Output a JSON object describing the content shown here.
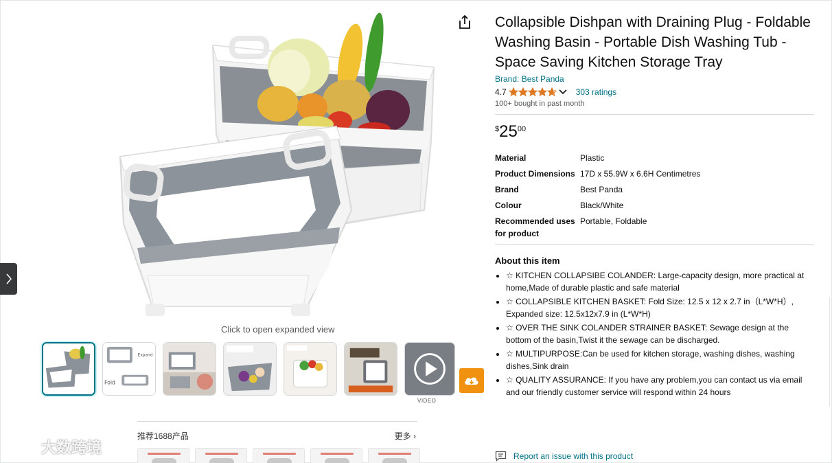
{
  "product": {
    "title": "Collapsible Dishpan with Draining Plug - Foldable Washing Basin - Portable Dish Washing Tub - Space Saving Kitchen Storage Tray",
    "brand_link": "Brand: Best Panda",
    "rating_value": "4.7",
    "rating_stars": 4.7,
    "ratings_count": "303 ratings",
    "bought_text": "100+ bought in past month",
    "price": {
      "symbol": "$",
      "whole": "25",
      "fraction": "00"
    }
  },
  "specs": [
    {
      "key": "Material",
      "value": "Plastic"
    },
    {
      "key": "Product Dimensions",
      "value": "17D x 55.9W x 6.6H Centimetres"
    },
    {
      "key": "Brand",
      "value": "Best Panda"
    },
    {
      "key": "Colour",
      "value": "Black/White"
    },
    {
      "key": "Recommended uses for product",
      "value": "Portable, Foldable"
    }
  ],
  "about": {
    "title": "About this item",
    "bullets": [
      "☆ KITCHEN COLLAPSIBE COLANDER: Large-capacity design, more practical at home,Made of durable plastic and safe material",
      "☆ COLLAPSIBLE KITCHEN BASKET: Fold Size: 12.5 x 12 x 2.7 in（L*W*H）, Expanded size: 12.5x12x7.9 in (L*W*H)",
      "☆ OVER THE SINK COLANDER STRAINER BASKET: Sewage design at the bottom of the basin,Twist it the sewage can be discharged.",
      "☆ MULTIPURPOSE:Can be used for kitchen storage, washing dishes, washing dishes,Sink drain",
      "☆ QUALITY ASSURANCE: If you have any problem,you can contact us via email and our friendly customer service will respond within 24 hours"
    ]
  },
  "report": {
    "label": "Report an issue with this product"
  },
  "gallery": {
    "expand_caption": "Click to open expanded view",
    "video_label": "VIDEO",
    "thumbnail_count": 7
  },
  "recommend": {
    "title": "推荐1688产品",
    "more": "更多 ›"
  },
  "watermark": {
    "text": "大数跨境"
  },
  "colors": {
    "link": "#007185",
    "star": "#de7921",
    "accent_orange": "#f0920f",
    "selected_thumb": "#007185"
  }
}
